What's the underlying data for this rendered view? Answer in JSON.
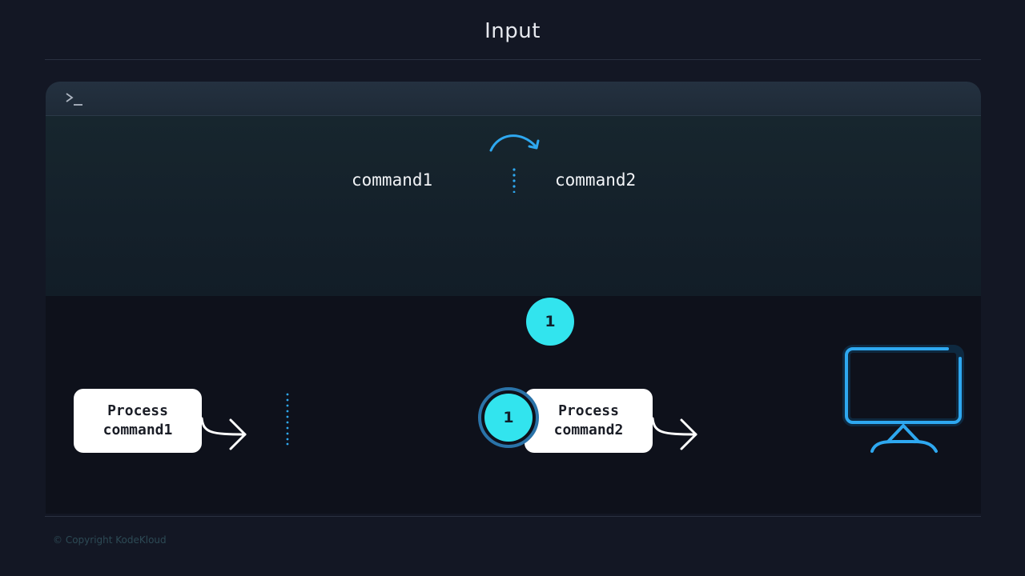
{
  "title": "Input",
  "terminal": {
    "prompt_icon": "terminal-prompt-icon",
    "command1": "command1",
    "command2": "command2"
  },
  "pipeline": {
    "step_badge": "1",
    "process1": {
      "line1": "Process",
      "line2": "command1"
    },
    "process2": {
      "badge": "1",
      "line1": "Process",
      "line2": "command2"
    },
    "output_icon": "monitor-icon"
  },
  "footer": "© Copyright KodeKloud",
  "colors": {
    "accent_cyan": "#32e4ee",
    "accent_blue": "#2ea8f0",
    "background": "#131724"
  }
}
